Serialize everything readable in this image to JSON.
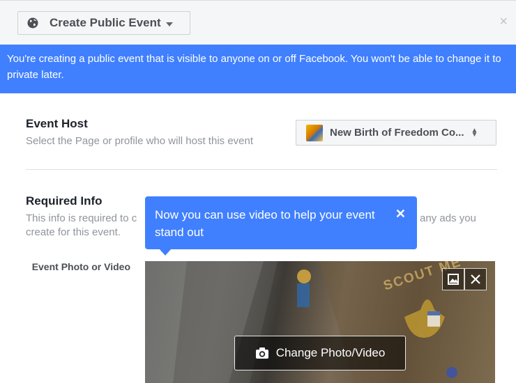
{
  "header": {
    "event_type_label": "Create Public Event",
    "close_glyph": "×"
  },
  "notice": {
    "text": "You're creating a public event that is visible to anyone on or off Facebook. You won't be able to change it to private later."
  },
  "host": {
    "title": "Event Host",
    "subtitle": "Select the Page or profile who will host this event",
    "selected": "New Birth of Freedom Co..."
  },
  "required": {
    "title": "Required Info",
    "subtitle_line1": "This info is required to c",
    "subtitle_line1_tail": "any ads you",
    "subtitle_line2": "create for this event."
  },
  "tooltip": {
    "text": "Now you can use video to help your event stand out",
    "close_glyph": "✕"
  },
  "photo": {
    "label": "Event Photo or Video",
    "change_label": "Change Photo/Video",
    "watermark": "SCOUT ME"
  },
  "colors": {
    "accent": "#4080ff",
    "header_bg": "#f5f6f7"
  },
  "icons": [
    "globe-icon",
    "caret-down-icon",
    "close-icon",
    "updown-icon",
    "photo-gallery-icon",
    "remove-icon",
    "camera-icon"
  ]
}
